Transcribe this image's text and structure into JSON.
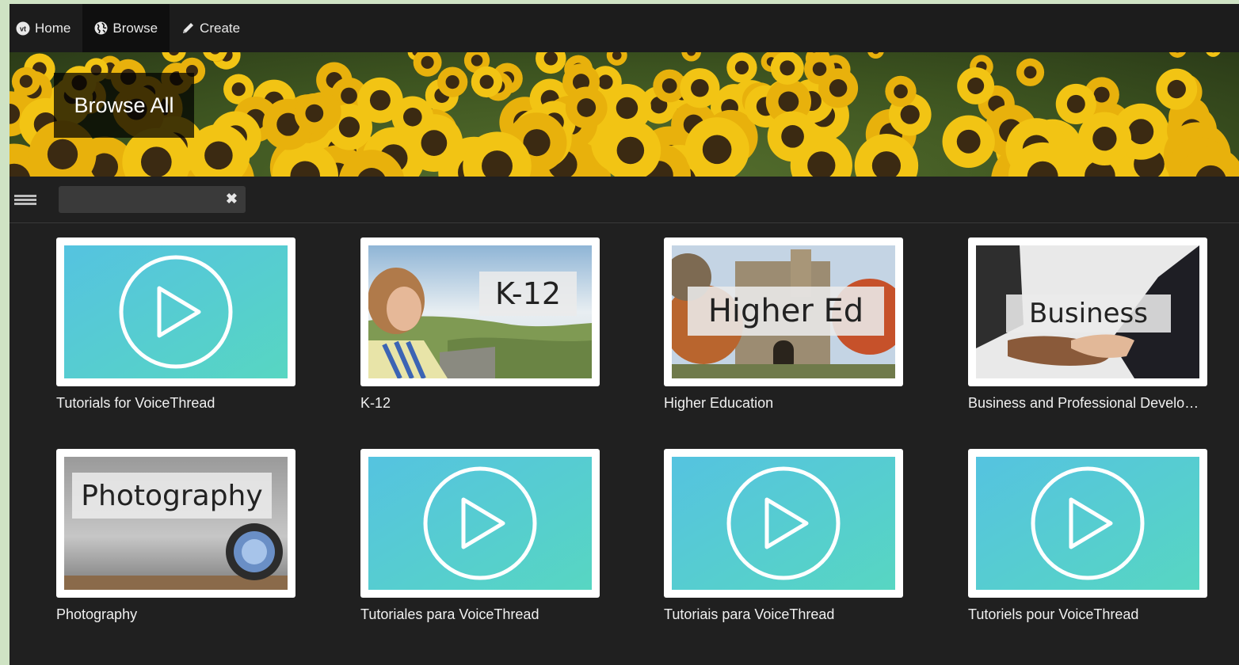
{
  "nav": {
    "home_label": "Home",
    "browse_label": "Browse",
    "create_label": "Create"
  },
  "banner": {
    "title": "Browse All"
  },
  "search": {
    "value": "",
    "placeholder": "",
    "clear_glyph": "✖"
  },
  "cards": [
    {
      "label": "Tutorials for VoiceThread",
      "thumb": "play-icon"
    },
    {
      "label": "K-12",
      "thumb": "photo",
      "caption": "K-12"
    },
    {
      "label": "Higher Education",
      "thumb": "photo",
      "caption": "Higher Ed"
    },
    {
      "label": "Business and Professional Development",
      "thumb": "photo",
      "caption": "Business"
    },
    {
      "label": "Photography",
      "thumb": "photo",
      "caption": "Photography"
    },
    {
      "label": "Tutoriales para VoiceThread",
      "thumb": "play-icon"
    },
    {
      "label": "Tutoriais para VoiceThread",
      "thumb": "play-icon"
    },
    {
      "label": "Tutoriels pour VoiceThread",
      "thumb": "play-icon"
    }
  ],
  "colors": {
    "page_bg": "#202020",
    "nav_bg": "#1c1c1c",
    "nav_active_bg": "#0f0f0f",
    "tutorial_gradient_start": "#55c3e0",
    "tutorial_gradient_end": "#57d6c2",
    "outer_bg": "#cfe3c4"
  }
}
